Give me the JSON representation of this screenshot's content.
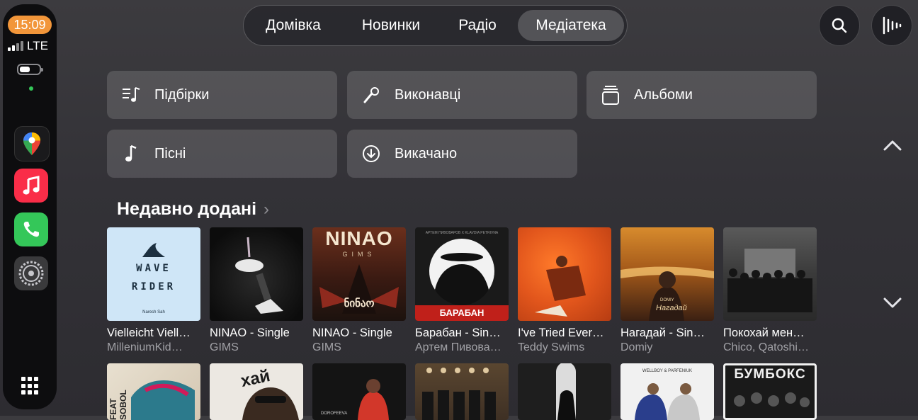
{
  "status": {
    "time": "15:09",
    "network": "LTE"
  },
  "dock": {
    "apps": [
      {
        "name": "maps-icon",
        "color": "#1a1a1c"
      },
      {
        "name": "music-icon",
        "color": "#fa2d48"
      },
      {
        "name": "phone-icon",
        "color": "#34c759"
      },
      {
        "name": "settings-icon",
        "color": "#8e8e93"
      }
    ]
  },
  "tabs": [
    {
      "label": "Домівка",
      "active": false
    },
    {
      "label": "Новинки",
      "active": false
    },
    {
      "label": "Радіо",
      "active": false
    },
    {
      "label": "Медіатека",
      "active": true
    }
  ],
  "library": {
    "items": [
      {
        "label": "Підбірки",
        "icon": "playlist-icon"
      },
      {
        "label": "Виконавці",
        "icon": "microphone-icon"
      },
      {
        "label": "Альбоми",
        "icon": "album-stack-icon"
      },
      {
        "label": "Пісні",
        "icon": "music-note-icon"
      },
      {
        "label": "Викачано",
        "icon": "download-icon"
      }
    ]
  },
  "recently_added": {
    "title": "Недавно додані",
    "albums": [
      {
        "title": "Vielleicht Viell…",
        "artist": "MilleniumKid…",
        "cover_text": [
          "WAVE",
          "RIDER",
          "Naresh Sah"
        ]
      },
      {
        "title": "NINAO - Single",
        "artist": "GIMS",
        "cover_text": []
      },
      {
        "title": "NINAO - Single",
        "artist": "GIMS",
        "cover_text": [
          "NINAO",
          "GIMS",
          "ნინაო"
        ]
      },
      {
        "title": "Барабан - Sin…",
        "artist": "Артем Пивова…",
        "cover_text": [
          "АРТЕМ ПИВОВАРОВ X KLAVDIA PETRIVNA",
          "БАРАБАН"
        ]
      },
      {
        "title": "I've Tried Ever…",
        "artist": "Teddy Swims",
        "cover_text": []
      },
      {
        "title": "Нагадай - Sin…",
        "artist": "Domiy",
        "cover_text": [
          "DOMIY",
          "Нагадай"
        ]
      },
      {
        "title": "Покохай мен…",
        "artist": "Chico, Qatoshi…",
        "cover_text": []
      }
    ],
    "row2_cover_text": [
      "FEAT SOBOL",
      "хай",
      "DOROFEEVA",
      "",
      "",
      "WELLBOY & PARFENIUK",
      "БУМБОКС"
    ]
  }
}
